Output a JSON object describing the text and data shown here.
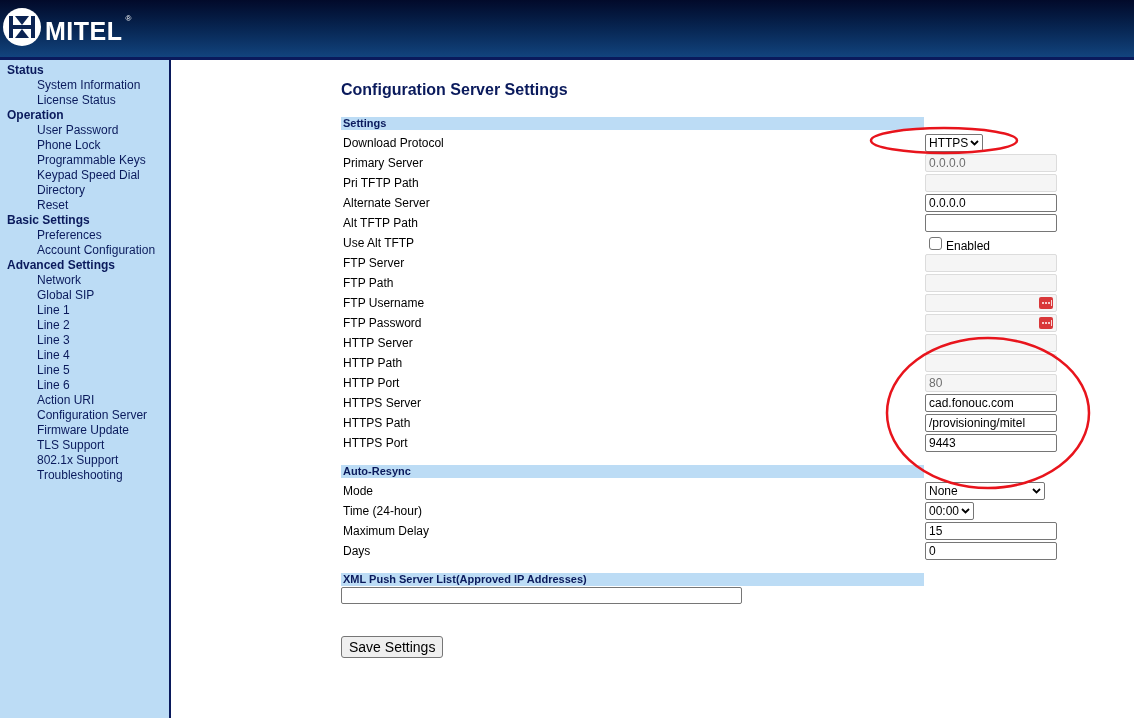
{
  "brand": {
    "name": "MITEL",
    "mark": "®"
  },
  "sidebar": [
    {
      "heading": "Status",
      "items": [
        {
          "label": "System Information",
          "selected": false
        },
        {
          "label": "License Status",
          "selected": false
        }
      ]
    },
    {
      "heading": "Operation",
      "items": [
        {
          "label": "User Password",
          "selected": false
        },
        {
          "label": "Phone Lock",
          "selected": false
        },
        {
          "label": "Programmable Keys",
          "selected": false
        },
        {
          "label": "Keypad Speed Dial",
          "selected": false
        },
        {
          "label": "Directory",
          "selected": false
        },
        {
          "label": "Reset",
          "selected": false
        }
      ]
    },
    {
      "heading": "Basic Settings",
      "items": [
        {
          "label": "Preferences",
          "selected": false
        },
        {
          "label": "Account Configuration",
          "selected": false
        }
      ]
    },
    {
      "heading": "Advanced Settings",
      "items": [
        {
          "label": "Network",
          "selected": false
        },
        {
          "label": "Global SIP",
          "selected": false
        },
        {
          "label": "Line 1",
          "selected": false
        },
        {
          "label": "Line 2",
          "selected": false
        },
        {
          "label": "Line 3",
          "selected": false
        },
        {
          "label": "Line 4",
          "selected": false
        },
        {
          "label": "Line 5",
          "selected": false
        },
        {
          "label": "Line 6",
          "selected": false
        },
        {
          "label": "Action URI",
          "selected": false
        },
        {
          "label": "Configuration Server",
          "selected": false
        },
        {
          "label": "Firmware Update",
          "selected": false
        },
        {
          "label": "TLS Support",
          "selected": false
        },
        {
          "label": "802.1x Support",
          "selected": false
        },
        {
          "label": "Troubleshooting",
          "selected": false
        }
      ]
    }
  ],
  "page_title": "Configuration Server Settings",
  "sections": [
    {
      "title": "Settings",
      "rows": [
        {
          "label": "Download Protocol",
          "kind": "select",
          "value": "HTTPS",
          "wide": false
        },
        {
          "label": "Primary Server",
          "kind": "text",
          "value": "0.0.0.0",
          "disabled": true
        },
        {
          "label": "Pri TFTP Path",
          "kind": "text",
          "disabled": true
        },
        {
          "label": "Alternate Server",
          "kind": "text",
          "value": "0.0.0.0",
          "disabled": false
        },
        {
          "label": "Alt TFTP Path",
          "kind": "text",
          "disabled": false
        },
        {
          "label": "Use Alt TFTP",
          "kind": "checkbox",
          "text": "Enabled",
          "checked": false
        },
        {
          "label": "FTP Server",
          "kind": "text",
          "disabled": true
        },
        {
          "label": "FTP Path",
          "kind": "text",
          "disabled": true
        },
        {
          "label": "FTP Username",
          "kind": "password",
          "disabled": true
        },
        {
          "label": "FTP Password",
          "kind": "password",
          "disabled": true
        },
        {
          "label": "HTTP Server",
          "kind": "text",
          "disabled": true
        },
        {
          "label": "HTTP Path",
          "kind": "text",
          "disabled": true
        },
        {
          "label": "HTTP Port",
          "kind": "text",
          "value": "80",
          "disabled": true
        },
        {
          "label": "HTTPS Server",
          "kind": "text",
          "value": "cad.fonouc.com",
          "disabled": false
        },
        {
          "label": "HTTPS Path",
          "kind": "text",
          "value": "/provisioning/mitel",
          "disabled": false
        },
        {
          "label": "HTTPS Port",
          "kind": "text",
          "value": "9443",
          "disabled": false
        }
      ]
    },
    {
      "title": "Auto-Resync",
      "rows": [
        {
          "label": "Mode",
          "kind": "select",
          "value": "None",
          "wide": true
        },
        {
          "label": "Time (24-hour)",
          "kind": "select",
          "value": "00:00",
          "wide": false
        },
        {
          "label": "Maximum Delay",
          "kind": "text",
          "value": "15",
          "disabled": false
        },
        {
          "label": "Days",
          "kind": "text",
          "value": "0",
          "disabled": false
        }
      ]
    }
  ],
  "xml_push": {
    "title": "XML Push Server List(Approved IP Addresses)"
  },
  "save_button": "Save Settings"
}
